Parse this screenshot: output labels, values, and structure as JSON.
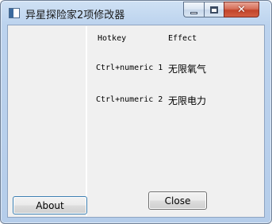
{
  "window": {
    "title": "异星探险家2项修改器"
  },
  "sidebar": {
    "about_label": "About"
  },
  "table": {
    "headers": {
      "hotkey": "Hotkey",
      "effect": "Effect"
    },
    "rows": [
      {
        "hotkey": "Ctrl+numeric 1",
        "effect": "无限氧气"
      },
      {
        "hotkey": "Ctrl+numeric 2",
        "effect": "无限电力"
      }
    ]
  },
  "footer": {
    "close_label": "Close"
  },
  "icons": {
    "app": "app-window-icon",
    "minimize": "minimize-icon",
    "maximize": "maximize-icon",
    "close": "close-icon"
  }
}
